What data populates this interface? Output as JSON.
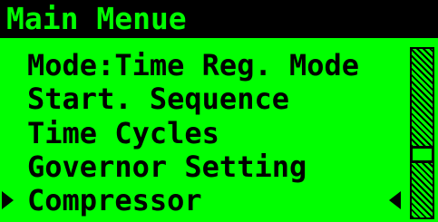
{
  "title": "Main Menue",
  "menu": {
    "items": [
      {
        "label": "Mode:Time Reg. Mode"
      },
      {
        "label": "Start. Sequence"
      },
      {
        "label": "Time Cycles"
      },
      {
        "label": "Governor Setting"
      },
      {
        "label": "Compressor"
      }
    ],
    "selected_index": 4
  },
  "scroll": {
    "position_fraction": 0.64
  },
  "colors": {
    "screen_bg": "#00ff00",
    "foreground": "#000000"
  }
}
